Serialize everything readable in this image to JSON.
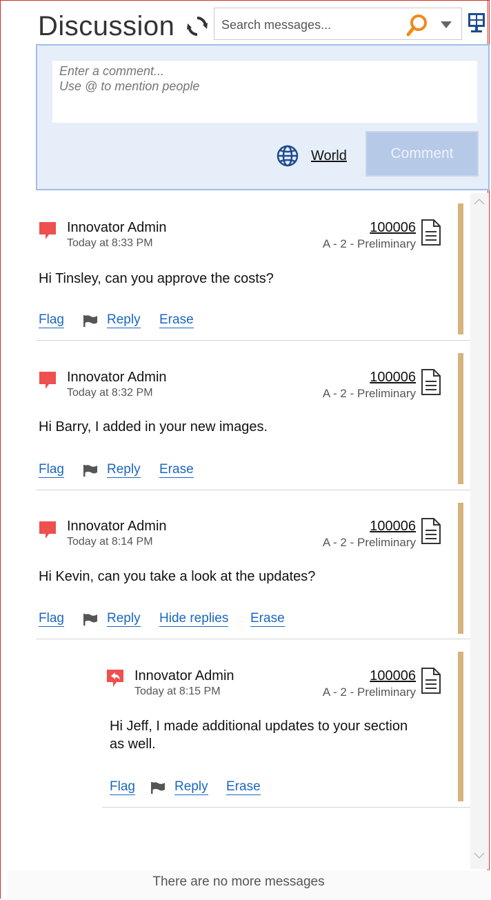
{
  "header": {
    "title": "Discussion",
    "refresh_icon": "refresh-icon",
    "search_placeholder": "Search messages...",
    "search_icon": "search-icon",
    "dropdown_icon": "chevron-down-icon",
    "screen_icon": "monitor-icon"
  },
  "composer": {
    "placeholder": "Enter a comment...\nUse @ to mention people",
    "visibility_label": "World",
    "globe_icon": "globe-icon",
    "comment_button": "Comment"
  },
  "messages": [
    {
      "author": "Innovator Admin",
      "time": "Today at 8:33 PM",
      "item_number": "100006",
      "state": "A - 2 - Preliminary",
      "text": "Hi Tinsley, can you approve the costs?",
      "actions": {
        "flag": "Flag",
        "reply": "Reply",
        "erase": "Erase"
      }
    },
    {
      "author": "Innovator Admin",
      "time": "Today at 8:32 PM",
      "item_number": "100006",
      "state": "A - 2 - Preliminary",
      "text": "Hi Barry, I added in your new images.",
      "actions": {
        "flag": "Flag",
        "reply": "Reply",
        "erase": "Erase"
      }
    },
    {
      "author": "Innovator Admin",
      "time": "Today at 8:14 PM",
      "item_number": "100006",
      "state": "A - 2 - Preliminary",
      "text": "Hi Kevin, can you take a look at the updates?",
      "actions": {
        "flag": "Flag",
        "reply": "Reply",
        "hide_replies": "Hide replies",
        "erase": "Erase"
      }
    }
  ],
  "reply": {
    "author": "Innovator Admin",
    "time": "Today at 8:15 PM",
    "item_number": "100006",
    "state": "A - 2 - Preliminary",
    "text": "Hi Jeff, I made additional updates to your section as well.",
    "actions": {
      "flag": "Flag",
      "reply": "Reply",
      "erase": "Erase"
    }
  },
  "footer": {
    "end_text": "There are no more messages"
  },
  "colors": {
    "message_icon": "#ee4f4f",
    "link": "#1a66c2",
    "accent_bar": "#d6b37c",
    "composer_bg": "#e6eef9",
    "comment_button": "#b6c9e6"
  }
}
